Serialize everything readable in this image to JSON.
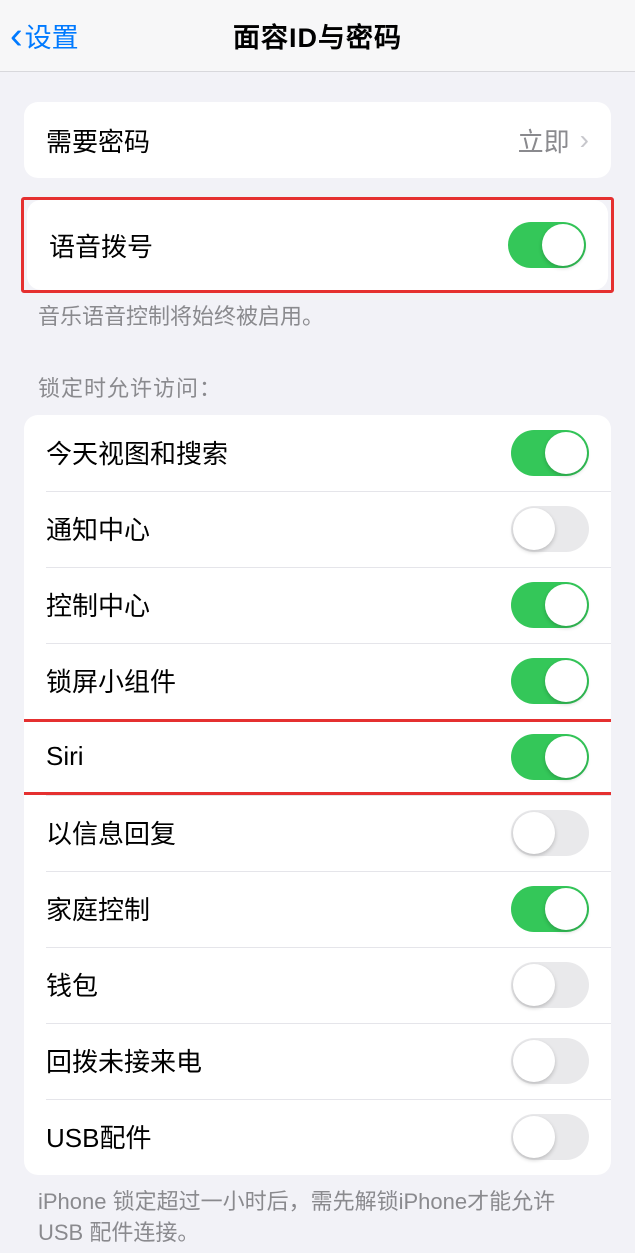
{
  "header": {
    "back_label": "设置",
    "title": "面容ID与密码"
  },
  "require_passcode": {
    "label": "需要密码",
    "value": "立即"
  },
  "voice_dial": {
    "label": "语音拨号",
    "on": true,
    "footer": "音乐语音控制将始终被启用。"
  },
  "locked_access": {
    "header": "锁定时允许访问：",
    "items": [
      {
        "label": "今天视图和搜索",
        "on": true
      },
      {
        "label": "通知中心",
        "on": false
      },
      {
        "label": "控制中心",
        "on": true
      },
      {
        "label": "锁屏小组件",
        "on": true
      },
      {
        "label": "Siri",
        "on": true
      },
      {
        "label": "以信息回复",
        "on": false
      },
      {
        "label": "家庭控制",
        "on": true
      },
      {
        "label": "钱包",
        "on": false
      },
      {
        "label": "回拨未接来电",
        "on": false
      },
      {
        "label": "USB配件",
        "on": false
      }
    ],
    "footer": "iPhone 锁定超过一小时后，需先解锁iPhone才能允许USB 配件连接。"
  }
}
